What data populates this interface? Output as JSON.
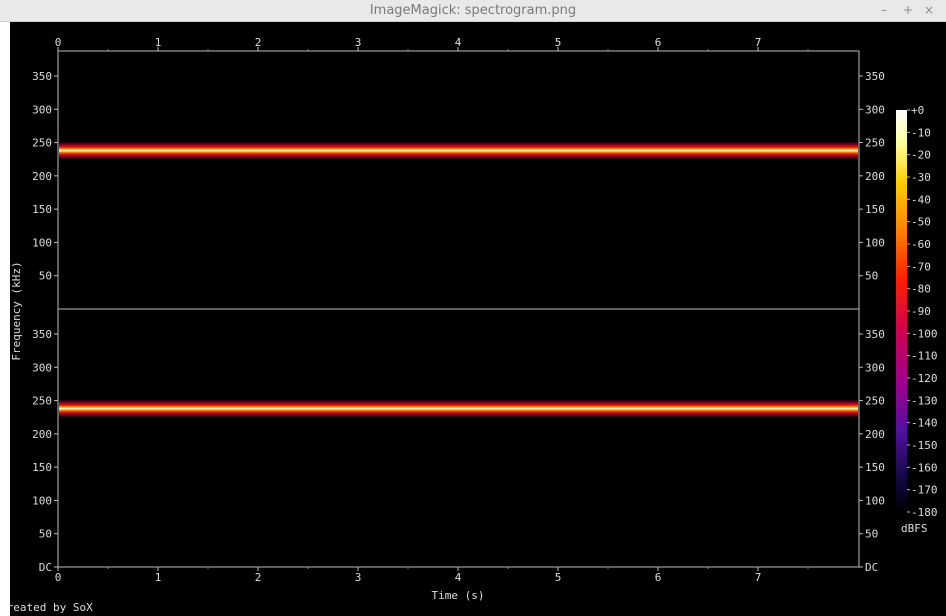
{
  "window": {
    "title": "ImageMagick: spectrogram.png",
    "controls": [
      "–",
      "+",
      "×"
    ]
  },
  "chart_data": {
    "type": "heatmap",
    "xlabel": "Time (s)",
    "ylabel": "Frequency (kHz)",
    "x_ticks": [
      "0",
      "1",
      "2",
      "3",
      "4",
      "5",
      "6",
      "7"
    ],
    "xlim": [
      0,
      8
    ],
    "channels": [
      {
        "y_ticks": [
          "50",
          "100",
          "150",
          "200",
          "250",
          "300",
          "350"
        ],
        "tone_khz": 238
      },
      {
        "y_ticks": [
          "DC",
          "50",
          "100",
          "150",
          "200",
          "250",
          "300",
          "350"
        ],
        "tone_khz": 238
      }
    ],
    "ylim": [
      0,
      400
    ],
    "colorbar": {
      "label": "dBFS",
      "ticks": [
        "+0",
        "-10",
        "-20",
        "-30",
        "-40",
        "-50",
        "-60",
        "-70",
        "-80",
        "-90",
        "-100",
        "-110",
        "-120",
        "-130",
        "-140",
        "-150",
        "-160",
        "-170",
        "-180"
      ]
    },
    "footer": "Created by SoX",
    "colors": {
      "background": "#000000",
      "tone_center": "#ffffc8",
      "tone_mid": "#ffb000",
      "tone_edge": "#c8002a",
      "axis": "#c0c0c0"
    }
  }
}
